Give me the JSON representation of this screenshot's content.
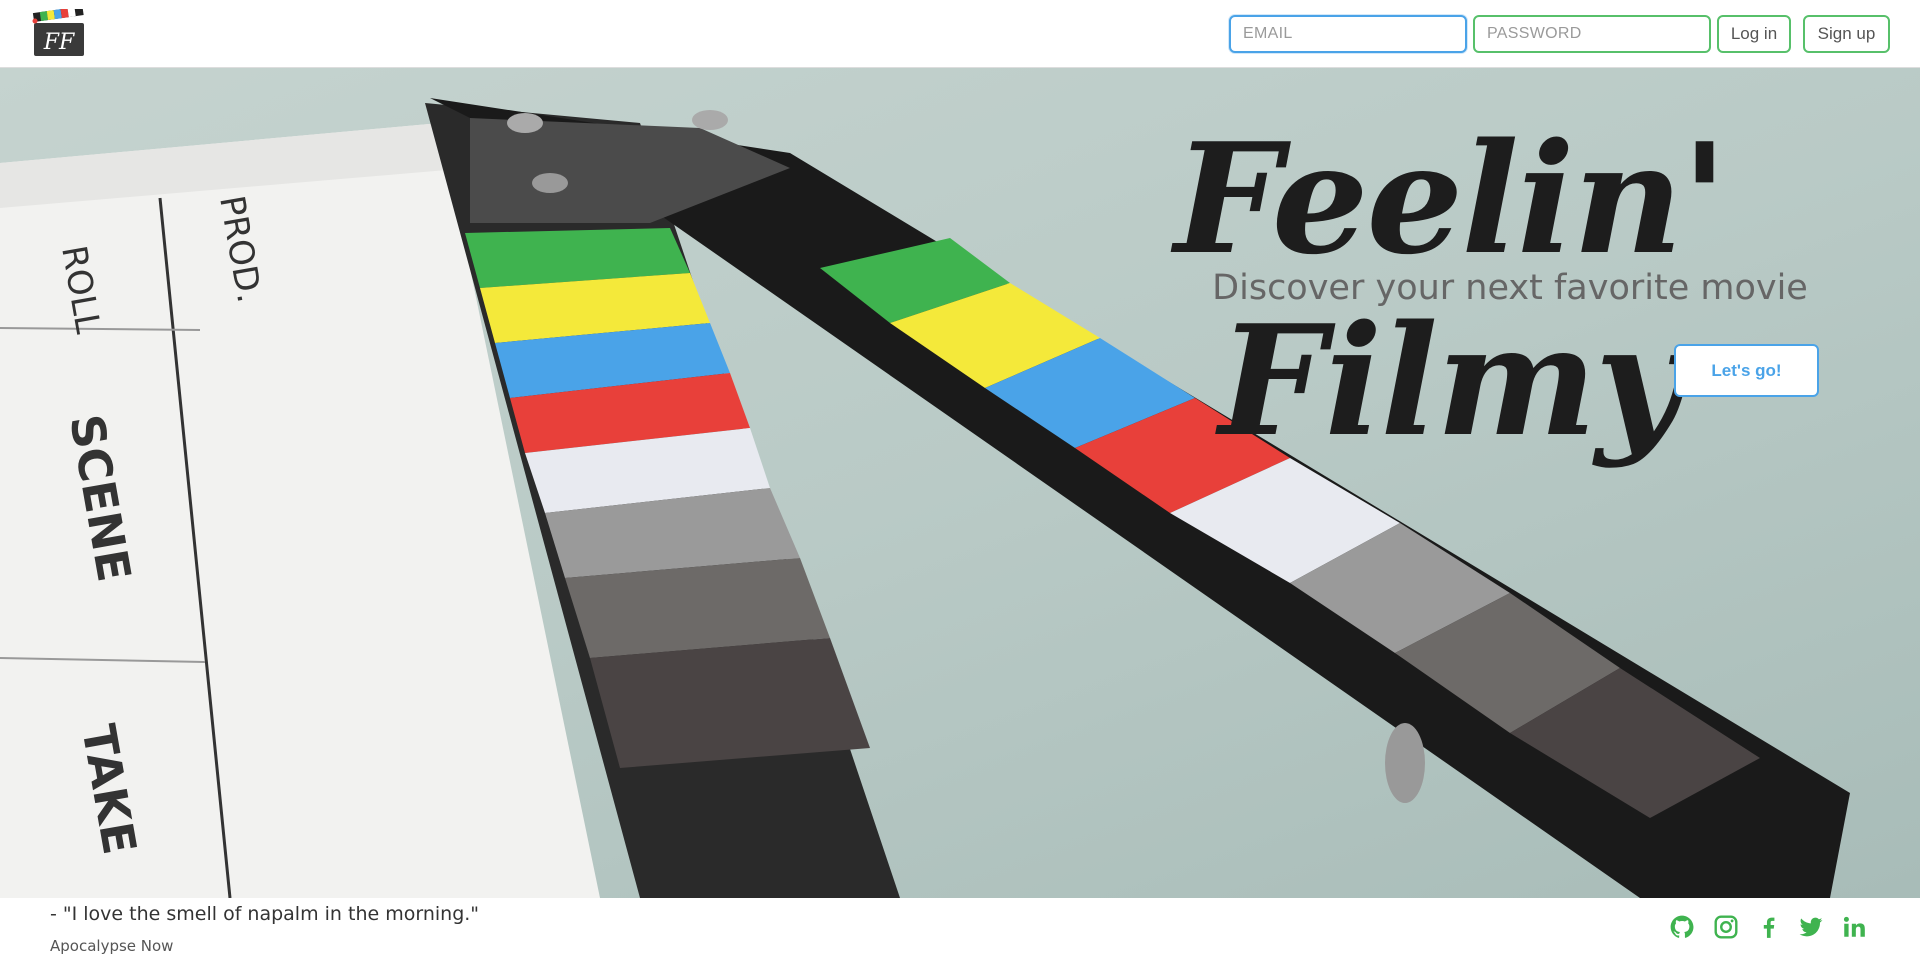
{
  "header": {
    "logo_letters": "FF",
    "email_placeholder": "EMAIL",
    "password_placeholder": "PASSWORD",
    "login_label": "Log in",
    "signup_label": "Sign up"
  },
  "hero": {
    "title": "Feelin' Filmy",
    "subtitle": "Discover your next favorite movie",
    "cta_label": "Let's go!",
    "slate_labels": {
      "roll": "ROLL",
      "prod": "PROD.",
      "scene": "SCENE",
      "take": "TAKE"
    }
  },
  "footer": {
    "quote": "- \"I love the smell of napalm in the morning.\"",
    "source": "Apocalypse Now",
    "social_icons": [
      "github-icon",
      "instagram-icon",
      "facebook-icon",
      "twitter-icon",
      "linkedin-icon"
    ]
  },
  "colors": {
    "accent_green": "#57c06a",
    "accent_blue": "#4aa3e8",
    "title_dark": "#1d1d1d"
  }
}
